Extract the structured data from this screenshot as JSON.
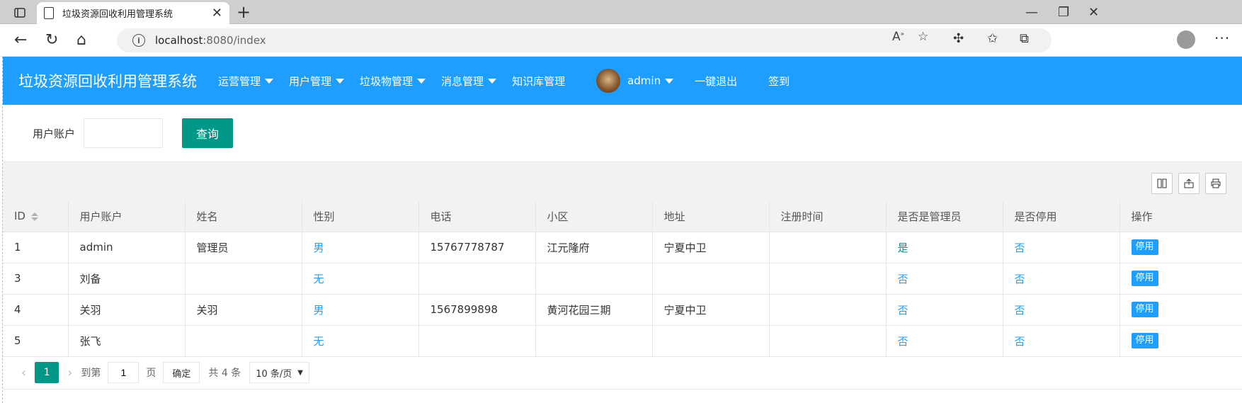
{
  "browser": {
    "tab_title": "垃圾资源回收利用管理系统",
    "url_host": "localhost",
    "url_rest": ":8080/index"
  },
  "app": {
    "title": "垃圾资源回收利用管理系统",
    "nav": [
      {
        "label": "运营管理",
        "dropdown": true
      },
      {
        "label": "用户管理",
        "dropdown": true
      },
      {
        "label": "垃圾物管理",
        "dropdown": true
      },
      {
        "label": "消息管理",
        "dropdown": true
      },
      {
        "label": "知识库管理",
        "dropdown": false
      }
    ],
    "username": "admin",
    "logout": "一键退出",
    "checkin": "签到"
  },
  "search": {
    "label": "用户账户",
    "value": "",
    "button": "查询"
  },
  "table": {
    "columns": [
      "ID",
      "用户账户",
      "姓名",
      "性别",
      "电话",
      "小区",
      "地址",
      "注册时间",
      "是否是管理员",
      "是否停用",
      "操作"
    ],
    "rows": [
      {
        "id": "1",
        "account": "admin",
        "name": "管理员",
        "gender": "男",
        "phone": "15767778787",
        "community": "江元隆府",
        "address": "宁夏中卫",
        "reg_time": "",
        "is_admin": "是",
        "disabled": "否",
        "action": "停用"
      },
      {
        "id": "3",
        "account": "刘备",
        "name": "",
        "gender": "无",
        "phone": "",
        "community": "",
        "address": "",
        "reg_time": "",
        "is_admin": "否",
        "disabled": "否",
        "action": "停用"
      },
      {
        "id": "4",
        "account": "关羽",
        "name": "关羽",
        "gender": "男",
        "phone": "1567899898",
        "community": "黄河花园三期",
        "address": "宁夏中卫",
        "reg_time": "",
        "is_admin": "否",
        "disabled": "否",
        "action": "停用"
      },
      {
        "id": "5",
        "account": "张飞",
        "name": "",
        "gender": "无",
        "phone": "",
        "community": "",
        "address": "",
        "reg_time": "",
        "is_admin": "否",
        "disabled": "否",
        "action": "停用"
      }
    ]
  },
  "pager": {
    "current_page": "1",
    "goto_label": "到第",
    "goto_value": "1",
    "page_label": "页",
    "confirm": "确定",
    "total": "共 4 条",
    "page_size": "10 条/页"
  }
}
